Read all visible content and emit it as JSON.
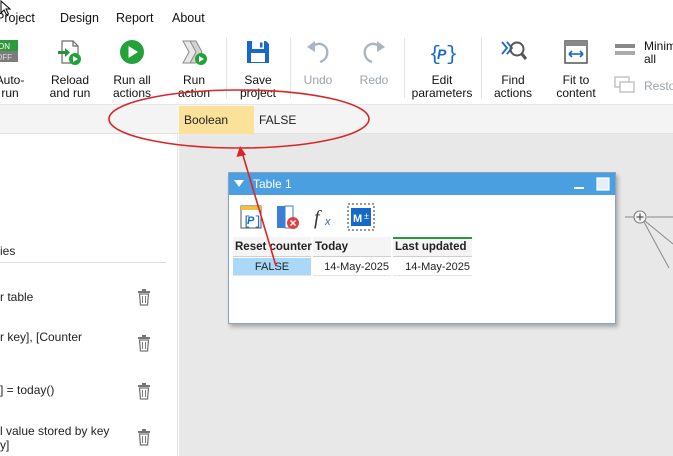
{
  "menubar": {
    "items": [
      "Project",
      "Design",
      "Report",
      "About"
    ]
  },
  "toolbar": {
    "auto_run": "Auto-\nrun",
    "reload_run": "Reload\nand run",
    "run_all": "Run all\nactions",
    "run_action": "Run\naction",
    "save_project": "Save\nproject",
    "undo": "Undo",
    "redo": "Redo",
    "edit_parameters": "Edit\nparameters",
    "find_actions": "Find\nactions",
    "fit_content": "Fit to\ncontent",
    "minimize_all": "Minim\nall",
    "restore": "Resto",
    "auto_run_badge_on": "ON",
    "auto_run_badge_off": "OFF"
  },
  "valuebar": {
    "type": "Boolean",
    "value": "FALSE"
  },
  "leftpanel": {
    "header": "ies",
    "items": [
      "r table",
      "r key], [Counter",
      "] = today()",
      "l value stored by key\ny]"
    ]
  },
  "table_window": {
    "title": "Table 1",
    "columns": [
      "Reset counter",
      "Today",
      "Last updated"
    ],
    "row": [
      "FALSE",
      "14-May-2025",
      "14-May-2025"
    ]
  },
  "colors": {
    "accent": "#4a9fe0",
    "highlight": "#fbe19a",
    "annotation": "#d9262a",
    "selected_cell": "#a9d8f8",
    "run_green": "#22a33a"
  }
}
